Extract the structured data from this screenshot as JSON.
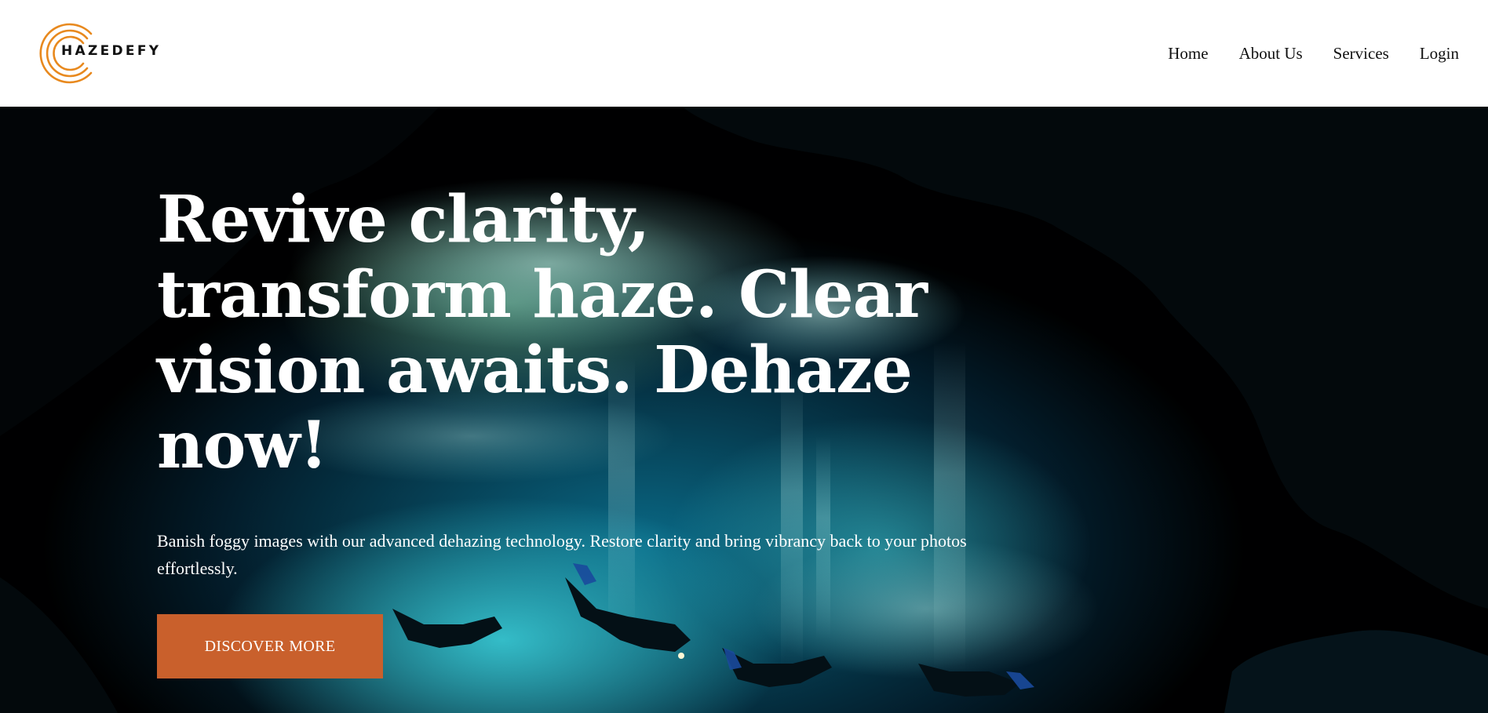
{
  "brand": {
    "name": "HAZEDEFY",
    "logo_icon": "concentric-c-rings-icon",
    "logo_color": "#E8891E"
  },
  "nav": {
    "items": [
      {
        "label": "Home"
      },
      {
        "label": "About Us"
      },
      {
        "label": "Services"
      },
      {
        "label": "Login"
      }
    ]
  },
  "hero": {
    "headline": "Revive clarity, transform haze. Clear vision awaits. Dehaze now!",
    "subtext": "Banish foggy images with our advanced dehazing technology. Restore clarity and bring vibrancy back to your photos effortlessly.",
    "cta_label": "DISCOVER MORE",
    "cta_color": "#C9602C",
    "background_image": "underwater-cave-divers-photo"
  }
}
